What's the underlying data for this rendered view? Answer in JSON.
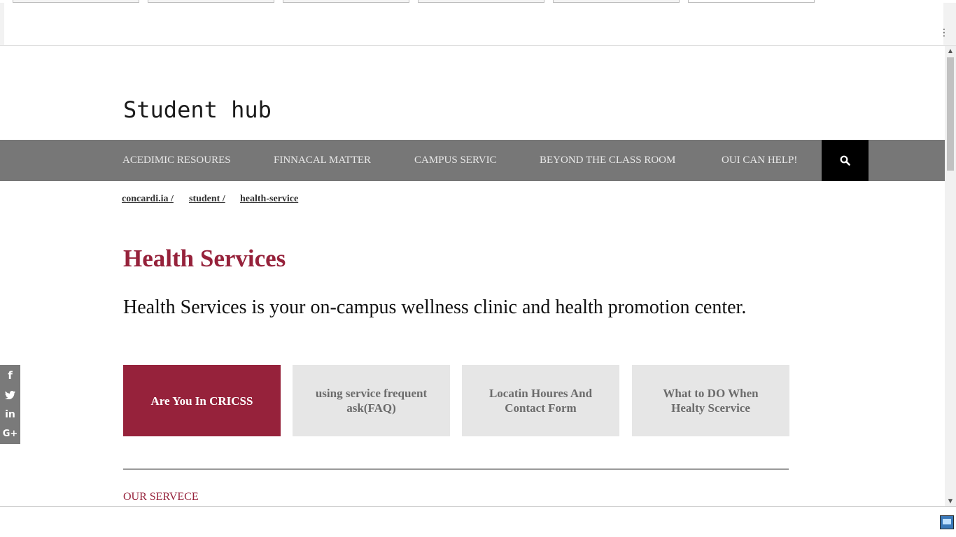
{
  "site": {
    "title": "Student hub"
  },
  "nav": {
    "items": [
      {
        "label": "ACEDIMIC RESOURES"
      },
      {
        "label": "FINNACAL MATTER"
      },
      {
        "label": "CAMPUS SERVIC"
      },
      {
        "label": "BEYOND THE CLASS ROOM"
      },
      {
        "label": "OUI CAN HELP!"
      }
    ],
    "search_icon": "search-icon"
  },
  "breadcrumb": {
    "items": [
      {
        "label": "concardi.ia /"
      },
      {
        "label": "student /"
      },
      {
        "label": "health-service"
      }
    ]
  },
  "main": {
    "heading": "Health Services",
    "intro": "Health Services is your on-campus wellness clinic and health promotion center.",
    "cards": [
      {
        "label": "Are You In CRICSS",
        "active": true
      },
      {
        "label": "using service frequent ask(FAQ)",
        "active": false
      },
      {
        "label": "Locatin Houres And Contact Form",
        "active": false
      },
      {
        "label": "What to DO When Healty Scervice",
        "active": false
      }
    ],
    "section_label": "OUR SERVECE"
  },
  "social": {
    "icons": [
      "facebook-icon",
      "twitter-icon",
      "linkedin-icon",
      "google-plus-icon"
    ]
  },
  "colors": {
    "accent": "#96223b",
    "nav_bg": "#777777",
    "search_bg": "#000000",
    "card_bg": "#e6e6e6"
  }
}
